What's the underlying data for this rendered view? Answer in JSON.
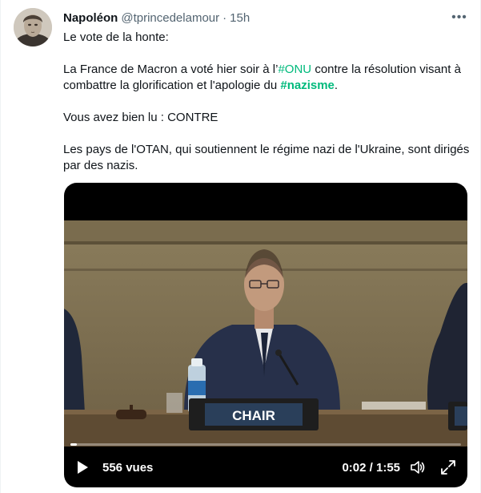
{
  "tweet": {
    "author": {
      "display_name": "Napoléon",
      "handle": "@tprincedelamour"
    },
    "separator": "·",
    "time": "15h",
    "more_icon": "more-horizontal-icon",
    "body": {
      "line1": "Le vote de la honte:",
      "p2_part1": "La France de Macron a voté hier soir à l’",
      "p2_hashtag1": "#ONU",
      "p2_part2": " contre la résolution visant à combattre la glorification et l'apologie du ",
      "p2_hashtag2": "#nazisme",
      "p2_part3": ".",
      "line3": "Vous avez bien lu : CONTRE",
      "line4": "Les pays de l'OTAN, qui soutiennent le régime nazi de l'Ukraine, sont dirigés par des nazis."
    }
  },
  "video": {
    "chair_placard": "CHAIR",
    "views": "556 vues",
    "time": "0:02 / 1:55",
    "progress": 0.017,
    "icons": [
      "play-icon",
      "volume-icon",
      "fullscreen-icon"
    ]
  },
  "colors": {
    "hashtag": "#00ba7c",
    "text": "#0f1419",
    "secondary": "#536471"
  }
}
